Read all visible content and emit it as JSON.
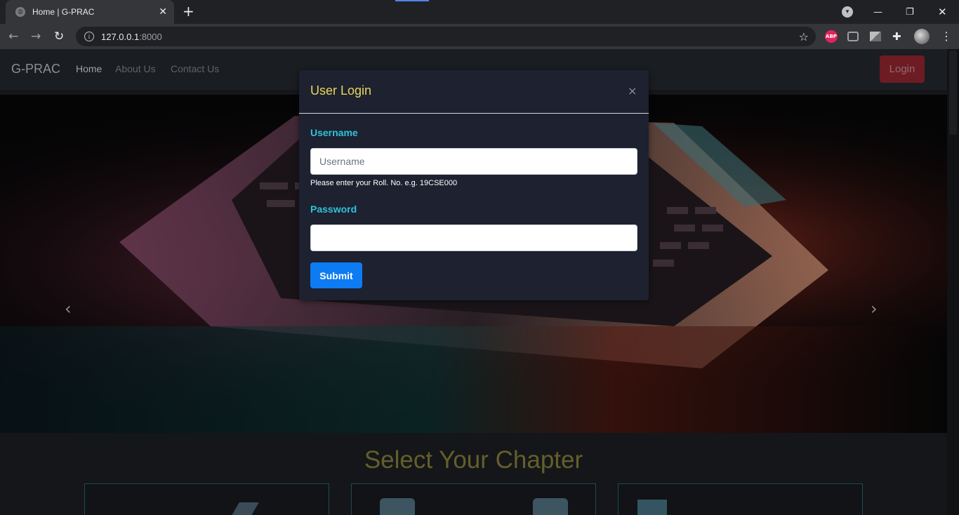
{
  "browser": {
    "tab_title": "Home | G-PRAC",
    "tab_close": "✕",
    "new_tab": "+",
    "url_host": "127.0.0.1",
    "url_port": ":8000",
    "ext_abp": "ABP",
    "window_min": "—",
    "window_restore": "❐",
    "window_close": "✕"
  },
  "navbar": {
    "brand": "G-PRAC",
    "links": [
      "Home",
      "About Us",
      "Contact Us"
    ],
    "login": "Login"
  },
  "modal": {
    "title": "User Login",
    "close": "×",
    "username_label": "Username",
    "username_placeholder": "Username",
    "username_help": "Please enter your Roll. No. e.g. 19CSE000",
    "password_label": "Password",
    "submit": "Submit"
  },
  "section": {
    "title": "Select Your Chapter"
  },
  "colors": {
    "modal_title": "#e7d85b",
    "label": "#2ec4d9",
    "submit": "#0d7bf2"
  }
}
